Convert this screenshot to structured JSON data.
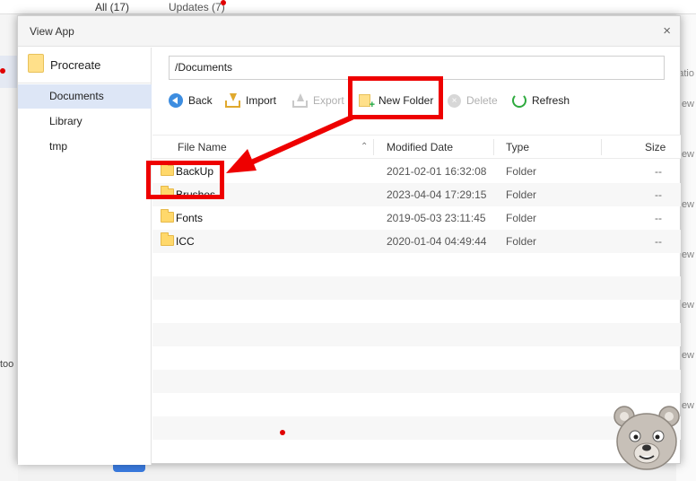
{
  "background": {
    "tabs": [
      "All (17)",
      "Updates (7)"
    ],
    "left_fragment": "too",
    "right_fragments": [
      "atio",
      "ew",
      "ew",
      "ew",
      "ew",
      "ew",
      "ew",
      "ew"
    ]
  },
  "dialog": {
    "title": "View App",
    "close_label": "×",
    "sidebar": {
      "app_name": "Procreate",
      "items": [
        {
          "label": "Documents",
          "active": true
        },
        {
          "label": "Library",
          "active": false
        },
        {
          "label": "tmp",
          "active": false
        }
      ]
    },
    "path": "/Documents",
    "toolbar": {
      "back": "Back",
      "import": "Import",
      "export": "Export",
      "new_folder": "New Folder",
      "delete": "Delete",
      "refresh": "Refresh"
    },
    "columns": {
      "name": "File Name",
      "modified": "Modified Date",
      "type": "Type",
      "size": "Size"
    },
    "files": [
      {
        "name": "BackUp",
        "modified": "2021-02-01 16:32:08",
        "type": "Folder",
        "size": "--"
      },
      {
        "name": "Brushes",
        "modified": "2023-04-04 17:29:15",
        "type": "Folder",
        "size": "--"
      },
      {
        "name": "Fonts",
        "modified": "2019-05-03 23:11:45",
        "type": "Folder",
        "size": "--"
      },
      {
        "name": "ICC",
        "modified": "2020-01-04 04:49:44",
        "type": "Folder",
        "size": "--"
      }
    ]
  },
  "colors": {
    "annotation_red": "#ee0000",
    "selection_blue": "#dde6f6",
    "folder_yellow": "#ffd86b"
  }
}
